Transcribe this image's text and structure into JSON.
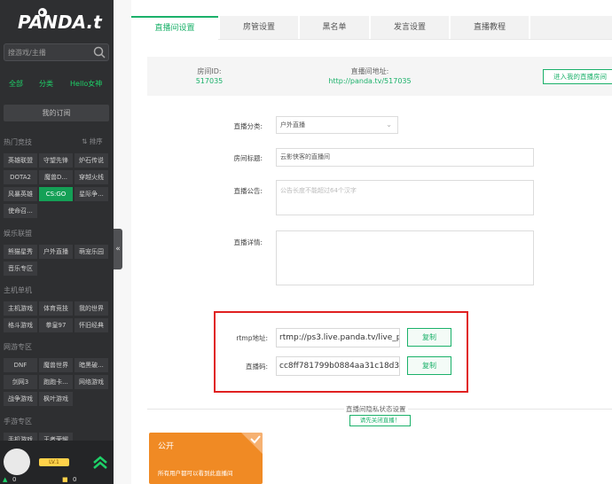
{
  "sidebar": {
    "logo_text": "PANDA.tv",
    "search_placeholder": "搜游戏/主播",
    "nav": [
      "全部",
      "分类",
      "Hello女神"
    ],
    "my_subscriptions": "我的订阅",
    "sections": [
      {
        "title": "热门竞技",
        "items": [
          "英雄联盟",
          "守望先锋",
          "炉石传说",
          "DOTA2",
          "魔兽D...",
          "穿越火线",
          "风暴英雄",
          "CS:GO",
          "星际争...",
          "使命召..."
        ]
      },
      {
        "title": "娱乐联盟",
        "items": [
          "熊猫星秀",
          "户外直播",
          "萌宠乐园",
          "音乐专区"
        ]
      },
      {
        "title": "主机单机",
        "items": [
          "主机游戏",
          "体育竞技",
          "我的世界",
          "格斗游戏",
          "拳皇97",
          "怀旧经典"
        ]
      },
      {
        "title": "网游专区",
        "items": [
          "DNF",
          "魔兽世界",
          "暗黑破...",
          "剑网3",
          "跑跑卡...",
          "网络游戏",
          "战争游戏",
          "枫叶游戏"
        ]
      },
      {
        "title": "手游专区",
        "items": [
          "手机游戏",
          "王者荣耀"
        ]
      }
    ],
    "active_item": "CS:GO",
    "sort_label": "排序",
    "user": {
      "level_badge": "LV.1",
      "bamboo": "0",
      "coins": "0"
    }
  },
  "tabs": [
    "直播间设置",
    "房管设置",
    "黑名单",
    "发言设置",
    "直播教程"
  ],
  "active_tab": "直播间设置",
  "room": {
    "id_label": "房间ID:",
    "id_value": "517035",
    "url_label": "直播间地址:",
    "url_value": "http://panda.tv/517035",
    "enter_button": "进入我的直播房间"
  },
  "form": {
    "category_label": "直播分类:",
    "category_value": "户外直播",
    "title_label": "房间标题:",
    "title_value": "云影侠客的直播间",
    "announcement_label": "直播公告:",
    "announcement_placeholder": "公告长度不能超过64个汉字",
    "details_label": "直播详情:",
    "details_value": ""
  },
  "stream": {
    "rtmp_label": "rtmp地址:",
    "rtmp_value": "rtmp://ps3.live.panda.tv/live_p",
    "key_label": "直播码:",
    "key_value": "cc8ff781799b0884aa31c18d39",
    "copy_label": "复制",
    "highlight_color": "#e02020"
  },
  "privacy": {
    "title": "直播间隐私状态设置",
    "status_button": "请先关闭直播！",
    "public_title": "公开",
    "public_desc": "所有用户都可以看到此直播间"
  },
  "colors": {
    "accent": "#1bb16a",
    "sidebar_bg": "#2e2f31",
    "orange": "#f08a24"
  }
}
